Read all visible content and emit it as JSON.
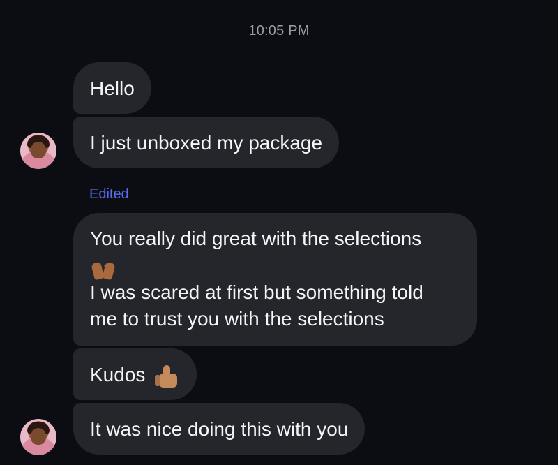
{
  "conversation": {
    "timestamp": "10:05 PM",
    "edited_label": "Edited",
    "messages": [
      {
        "text": "Hello"
      },
      {
        "text": "I just unboxed my package"
      },
      {
        "line1": "You really did great with the selections",
        "emoji1": "raising-hands-emoji",
        "line2": "I was scared at first but something told",
        "line3": "me to trust you with the selections"
      },
      {
        "text": "Kudos",
        "emoji": "thumbs-up-emoji"
      },
      {
        "text": "It was nice doing this with you"
      }
    ]
  },
  "colors": {
    "background": "#0b0d12",
    "bubble": "#24262c",
    "edited_accent": "#5b6cf2",
    "timestamp": "#9a9ca3"
  }
}
